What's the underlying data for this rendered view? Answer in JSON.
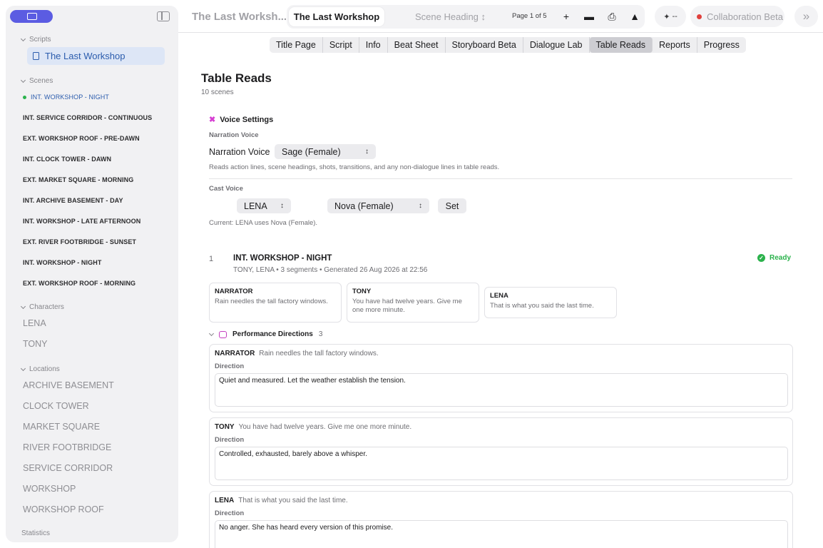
{
  "sidebar": {
    "scripts_header": "Scripts",
    "script_item": "The Last Workshop",
    "scenes_header": "Scenes",
    "scenes": [
      "INT. WORKSHOP - NIGHT",
      "INT. SERVICE CORRIDOR - CONTINUOUS",
      "EXT. WORKSHOP ROOF - PRE-DAWN",
      "INT. CLOCK TOWER - DAWN",
      "EXT. MARKET SQUARE - MORNING",
      "INT. ARCHIVE BASEMENT - DAY",
      "INT. WORKSHOP - LATE AFTERNOON",
      "EXT. RIVER FOOTBRIDGE - SUNSET",
      "INT. WORKSHOP - NIGHT",
      "EXT. WORKSHOP ROOF - MORNING"
    ],
    "characters_header": "Characters",
    "characters": [
      "LENA",
      "TONY"
    ],
    "locations_header": "Locations",
    "locations": [
      "ARCHIVE BASEMENT",
      "CLOCK TOWER",
      "MARKET SQUARE",
      "RIVER FOOTBRIDGE",
      "SERVICE CORRIDOR",
      "WORKSHOP",
      "WORKSHOP ROOF"
    ],
    "statistics_header": "Statistics"
  },
  "toolbar": {
    "doc_title": "The Last Worksh...",
    "active_tab": "The Last Workshop",
    "scene_heading": "Scene Heading",
    "page_indicator": "Page 1 of 5",
    "ai_label": "--",
    "collab_label": "Collaboration Beta"
  },
  "nav": {
    "tabs": [
      "Title Page",
      "Script",
      "Info",
      "Beat Sheet",
      "Storyboard Beta",
      "Dialogue Lab",
      "Table Reads",
      "Reports",
      "Progress"
    ],
    "selected": "Table Reads"
  },
  "main": {
    "title": "Table Reads",
    "subtitle": "10 scenes",
    "voice_settings": {
      "header": "Voice Settings",
      "narration_label": "Narration Voice",
      "narration_field_label": "Narration Voice",
      "narration_value": "Sage (Female)",
      "narration_hint": "Reads action lines, scene headings, shots, transitions, and any non-dialogue lines in table reads.",
      "cast_label": "Cast Voice",
      "cast_character": "LENA",
      "cast_voice": "Nova (Female)",
      "set_label": "Set",
      "current_text": "Current: LENA uses Nova (Female)."
    },
    "scene": {
      "number": "1",
      "title": "INT. WORKSHOP - NIGHT",
      "meta": "TONY, LENA • 3 segments • Generated 26 Aug 2026 at 22:56",
      "status": "Ready",
      "segments": [
        {
          "speaker": "NARRATOR",
          "text": "Rain needles the tall factory windows."
        },
        {
          "speaker": "TONY",
          "text": "You have had twelve years. Give me one more minute."
        },
        {
          "speaker": "LENA",
          "text": "That is what you said the last time."
        }
      ],
      "directions_header": "Performance Directions",
      "directions_count": "3",
      "direction_label": "Direction",
      "directions": [
        {
          "speaker": "NARRATOR",
          "line": "Rain needles the tall factory windows.",
          "direction": "Quiet and measured. Let the weather establish the tension."
        },
        {
          "speaker": "TONY",
          "line": "You have had twelve years. Give me one more minute.",
          "direction": "Controlled, exhausted, barely above a whisper."
        },
        {
          "speaker": "LENA",
          "line": "That is what you said the last time.",
          "direction": "No anger. She has heard every version of this promise."
        }
      ]
    }
  }
}
